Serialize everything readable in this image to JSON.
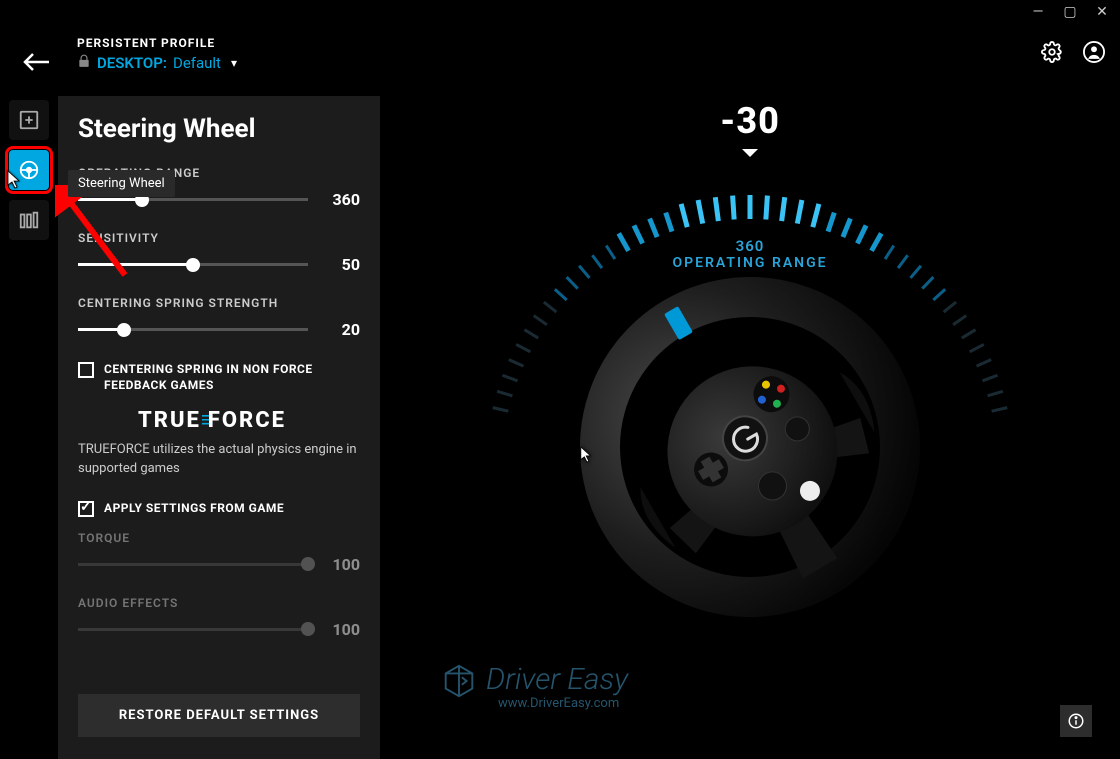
{
  "window": {
    "minimize": "—",
    "maximize": "▢",
    "close": "✕"
  },
  "header": {
    "profile_label": "PERSISTENT PROFILE",
    "profile_scope": "DESKTOP:",
    "profile_name": "Default"
  },
  "toolbar": {
    "tooltip": "Steering Wheel"
  },
  "panel": {
    "title": "Steering Wheel",
    "operating_range": {
      "label": "OPERATING RANGE",
      "value": "360",
      "percent": 28
    },
    "sensitivity": {
      "label": "SENSITIVITY",
      "value": "50",
      "percent": 50
    },
    "centering": {
      "label": "CENTERING SPRING STRENGTH",
      "value": "20",
      "percent": 20
    },
    "centering_nonffb": {
      "label": "CENTERING SPRING IN NON FORCE FEEDBACK GAMES",
      "checked": false
    },
    "trueforce": {
      "logo_pre": "TRUE",
      "logo_post": "ORCE",
      "desc": "TRUEFORCE utilizes the actual physics engine in supported games"
    },
    "apply_from_game": {
      "label": "APPLY SETTINGS FROM GAME",
      "checked": true
    },
    "torque": {
      "label": "TORQUE",
      "value": "100",
      "percent": 100
    },
    "audio_effects": {
      "label": "AUDIO EFFECTS",
      "value": "100",
      "percent": 100
    },
    "restore": "RESTORE DEFAULT SETTINGS"
  },
  "stage": {
    "angle": "-30",
    "range_value": "360",
    "range_label": "OPERATING RANGE"
  },
  "watermark": {
    "title": "Driver Easy",
    "url": "www.DriverEasy.com"
  }
}
